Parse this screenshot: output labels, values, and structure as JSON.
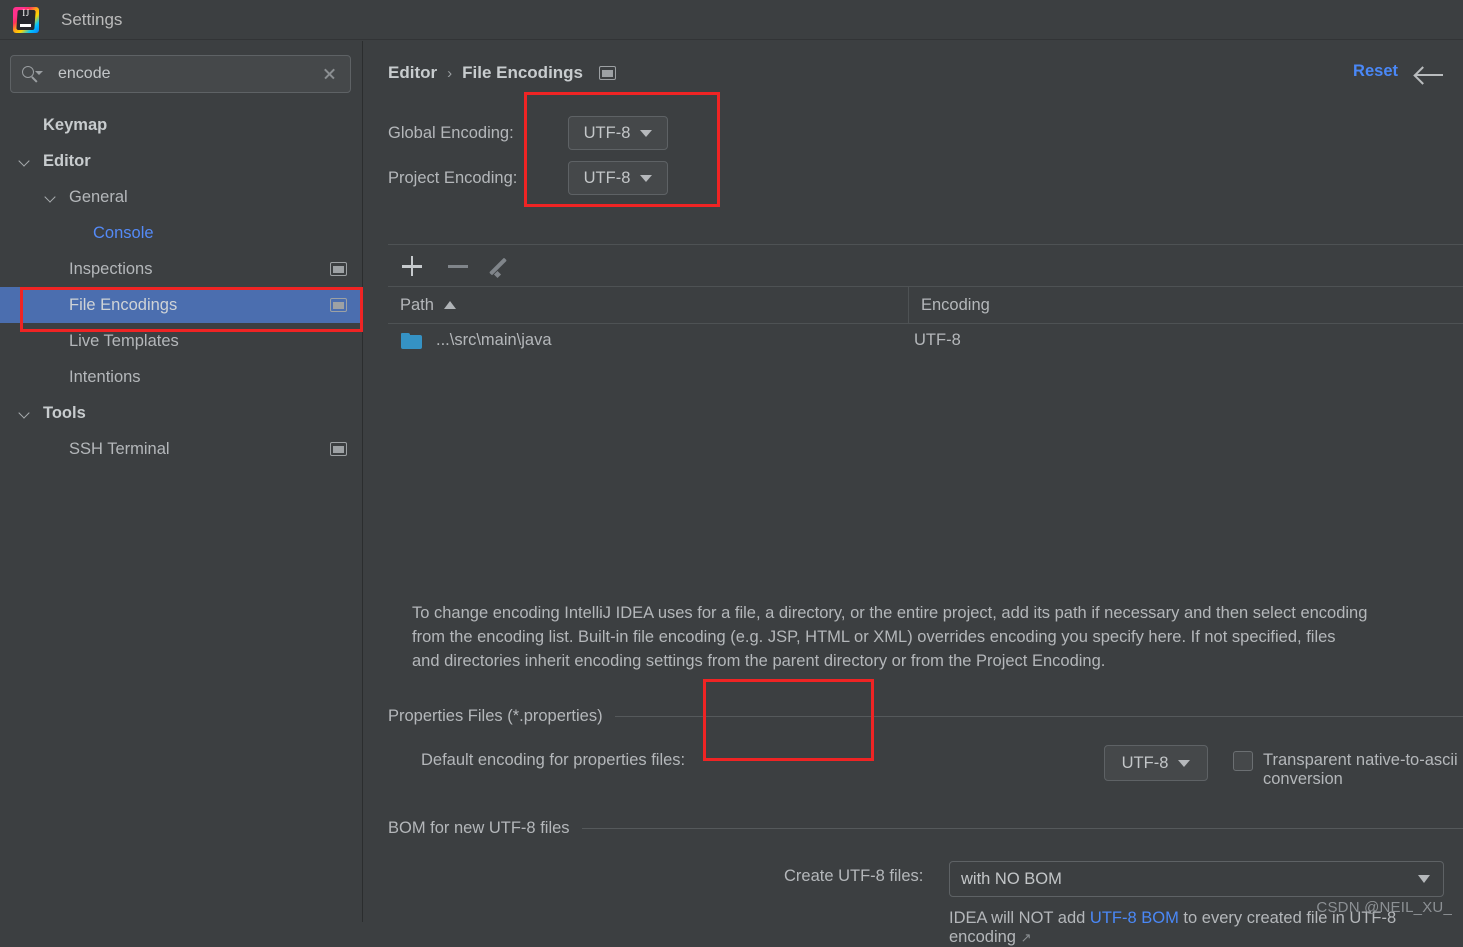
{
  "window": {
    "title": "Settings",
    "logo_icon": "intellij-idea-logo"
  },
  "sidebar": {
    "search": {
      "value": "encode",
      "placeholder": "",
      "icon": "search-icon",
      "clear_icon": "close-icon"
    },
    "items": [
      {
        "label": "Keymap",
        "level": 0,
        "bold": true,
        "twisty": false,
        "badge": false,
        "selected": false,
        "link": false
      },
      {
        "label": "Editor",
        "level": 0,
        "bold": true,
        "twisty": true,
        "badge": false,
        "selected": false,
        "link": false
      },
      {
        "label": "General",
        "level": 1,
        "bold": false,
        "twisty": true,
        "badge": false,
        "selected": false,
        "link": false
      },
      {
        "label": "Console",
        "level": 2,
        "bold": false,
        "twisty": false,
        "badge": false,
        "selected": false,
        "link": true
      },
      {
        "label": "Inspections",
        "level": 1,
        "bold": false,
        "twisty": false,
        "badge": true,
        "selected": false,
        "link": false
      },
      {
        "label": "File Encodings",
        "level": 1,
        "bold": false,
        "twisty": false,
        "badge": true,
        "selected": true,
        "link": false
      },
      {
        "label": "Live Templates",
        "level": 1,
        "bold": false,
        "twisty": false,
        "badge": false,
        "selected": false,
        "link": false
      },
      {
        "label": "Intentions",
        "level": 1,
        "bold": false,
        "twisty": false,
        "badge": false,
        "selected": false,
        "link": false
      },
      {
        "label": "Tools",
        "level": 0,
        "bold": true,
        "twisty": true,
        "badge": false,
        "selected": false,
        "link": false
      },
      {
        "label": "SSH Terminal",
        "level": 1,
        "bold": false,
        "twisty": false,
        "badge": true,
        "selected": false,
        "link": false
      }
    ]
  },
  "header": {
    "crumb_root": "Editor",
    "crumb_sep": "›",
    "crumb_leaf": "File Encodings",
    "crumb_badge_icon": "settings-page-icon",
    "reset_label": "Reset",
    "back_icon": "arrow-left-icon"
  },
  "encodings": {
    "global_label": "Global Encoding:",
    "global_value": "UTF-8",
    "project_label": "Project Encoding:",
    "project_value": "UTF-8"
  },
  "toolbar": {
    "add_icon": "plus-icon",
    "remove_icon": "minus-icon",
    "edit_icon": "pencil-icon"
  },
  "table": {
    "columns": [
      "Path",
      "Encoding"
    ],
    "sort_column": "Path",
    "sort_direction": "ascending",
    "rows": [
      {
        "path": "...\\src\\main\\java",
        "encoding": "UTF-8",
        "icon": "folder-icon"
      }
    ]
  },
  "description": "To change encoding IntelliJ IDEA uses for a file, a directory, or the entire project, add its path if necessary and then select encoding\nfrom the encoding list. Built-in file encoding (e.g. JSP, HTML or XML) overrides encoding you specify here. If not specified, files\nand directories inherit encoding settings from the parent directory or from the Project Encoding.",
  "properties_group": {
    "title": "Properties Files (*.properties)",
    "default_encoding_label": "Default encoding for properties files:",
    "default_encoding_value": "UTF-8",
    "ascii_checkbox_label": "Transparent native-to-ascii conversion",
    "ascii_checkbox_checked": false
  },
  "bom_group": {
    "title": "BOM for new UTF-8 files",
    "create_label": "Create UTF-8 files:",
    "create_value": "with NO BOM",
    "hint_prefix": "IDEA will NOT add ",
    "hint_link": "UTF-8 BOM",
    "hint_suffix": " to every created file in UTF-8 encoding ",
    "hint_external_icon": "↗"
  },
  "watermark": "CSDN @NEIL_XU_",
  "colors": {
    "background": "#3c3f41",
    "selection": "#4b6eaf",
    "accent_link": "#4a88f7",
    "annotation": "#ef2424",
    "folder": "#3592c4",
    "text": "#b4b7ba"
  }
}
